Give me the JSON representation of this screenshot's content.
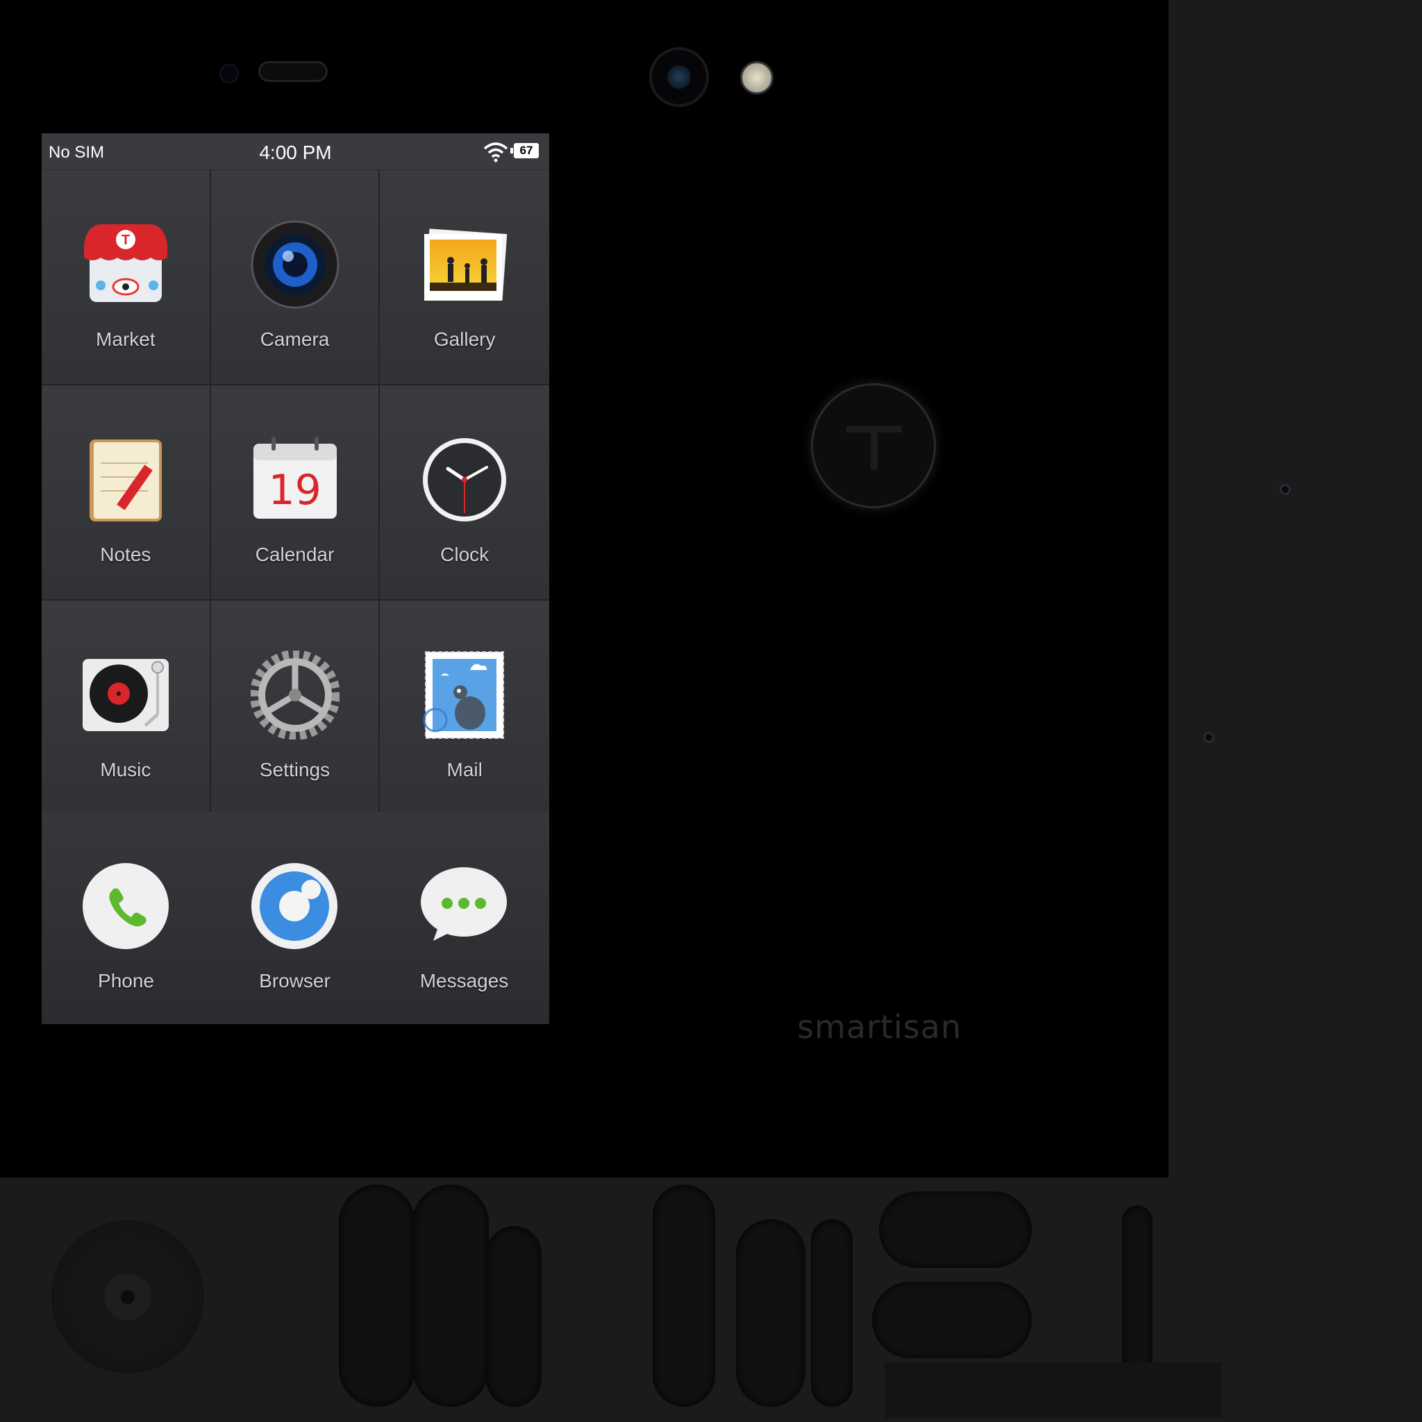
{
  "status_bar": {
    "carrier": "No SIM",
    "time": "4:00 PM",
    "battery": "67",
    "wifi_icon": "wifi-icon"
  },
  "apps": [
    {
      "label": "Market",
      "icon": "market-icon"
    },
    {
      "label": "Camera",
      "icon": "camera-icon"
    },
    {
      "label": "Gallery",
      "icon": "gallery-icon"
    },
    {
      "label": "Notes",
      "icon": "notes-icon"
    },
    {
      "label": "Calendar",
      "icon": "calendar-icon",
      "date": "19"
    },
    {
      "label": "Clock",
      "icon": "clock-icon"
    },
    {
      "label": "Music",
      "icon": "music-icon"
    },
    {
      "label": "Settings",
      "icon": "settings-icon"
    },
    {
      "label": "Mail",
      "icon": "mail-icon"
    }
  ],
  "dock": [
    {
      "label": "Phone",
      "icon": "phone-icon"
    },
    {
      "label": "Browser",
      "icon": "browser-icon"
    },
    {
      "label": "Messages",
      "icon": "messages-icon"
    }
  ],
  "device": {
    "brand": "smartisan"
  },
  "colors": {
    "screen_bg": "#2c2d31",
    "label": "#d4d4d6",
    "market_red": "#d8262a",
    "phone_green": "#5cb82e",
    "browser_blue": "#3a8de0"
  }
}
